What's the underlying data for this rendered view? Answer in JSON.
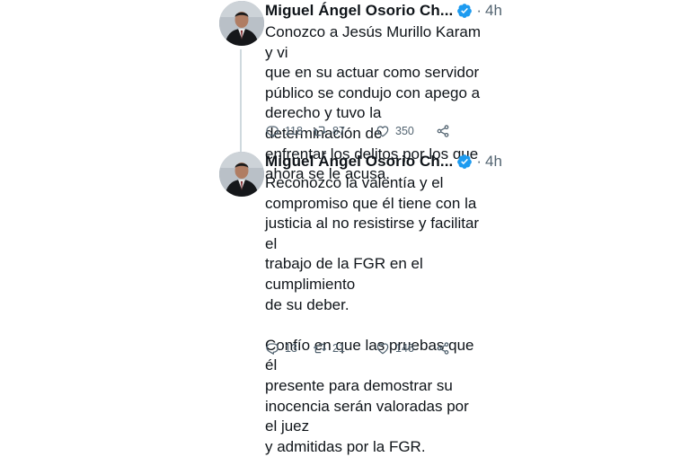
{
  "tweets": [
    {
      "author": "Miguel Ángel Osorio Ch...",
      "separator": "·",
      "time": "4h",
      "text": "Conozco a Jesús Murillo Karam y vi\nque en su actuar como servidor\npúblico se condujo con apego a\nderecho y tuvo la determinación de\nenfrentar los delitos por los que\nahora se le acusa.",
      "replies": "118",
      "retweets": "87",
      "likes": "350"
    },
    {
      "author": "Miguel Ángel Osorio Ch...",
      "separator": "·",
      "time": "4h",
      "text": "Reconozco la valentía y el\ncompromiso que él tiene con la\njusticia al no resistirse y facilitar el\ntrabajo de la FGR en el cumplimiento\nde su deber.\n\nConfío en que las pruebas que él\npresente para demostrar su\ninocencia serán valoradas por el juez\ny admitidas por la FGR.",
      "replies": "13",
      "retweets": "21",
      "likes": "146"
    }
  ],
  "colors": {
    "verified_badge": "#1d9bf0",
    "secondary_text": "#536471",
    "thread_line": "#cfd9de"
  },
  "icons": [
    "reply-icon",
    "retweet-icon",
    "like-icon",
    "share-icon",
    "verified-badge-icon"
  ]
}
